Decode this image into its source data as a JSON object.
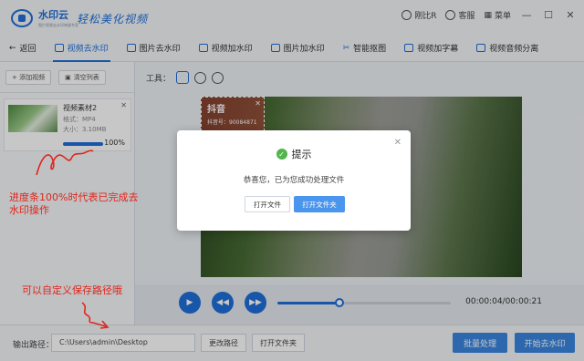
{
  "app": {
    "name": "水印云",
    "subtitle": "图片视频去水印神器专家",
    "slogan": "轻松美化视频"
  },
  "titlebar": {
    "user": "刚比R",
    "service": "客服",
    "menu": "菜单"
  },
  "nav": {
    "back": "返回",
    "tabs": [
      "视频去水印",
      "图片去水印",
      "视频加水印",
      "图片加水印",
      "智能抠图",
      "视频加字幕",
      "视频音频分离"
    ],
    "active": "视频去水印"
  },
  "sidebar": {
    "add_video": "+ 添加视频",
    "clear_list": "清空列表",
    "file": {
      "name": "视频素材2",
      "format": "格式：MP4",
      "size": "大小：3.10MB",
      "progress": 1.0,
      "progress_label": "100%"
    }
  },
  "annotations": {
    "progress_note": "进度条100%时代表已完成去水印操作",
    "path_note": "可以自定义保存路径哦"
  },
  "tools": {
    "label": "工具："
  },
  "video": {
    "watermark": {
      "app": "抖音",
      "id": "抖音号：90084871"
    },
    "seek_fraction": 0.36,
    "time": "00:00:04/00:00:21"
  },
  "bottombar": {
    "output_label": "输出路径：",
    "output_path": "C:\\Users\\admin\\Desktop",
    "change_path": "更改路径",
    "open_folder": "打开文件夹",
    "batch": "批量处理",
    "start": "开始去水印"
  },
  "dialog": {
    "title": "提示",
    "message": "恭喜您，已为您成功处理文件",
    "open_file": "打开文件",
    "open_folder": "打开文件夹"
  },
  "colors": {
    "accent": "#1e6fd9",
    "annotation": "#e0251b",
    "success": "#52b54b"
  }
}
